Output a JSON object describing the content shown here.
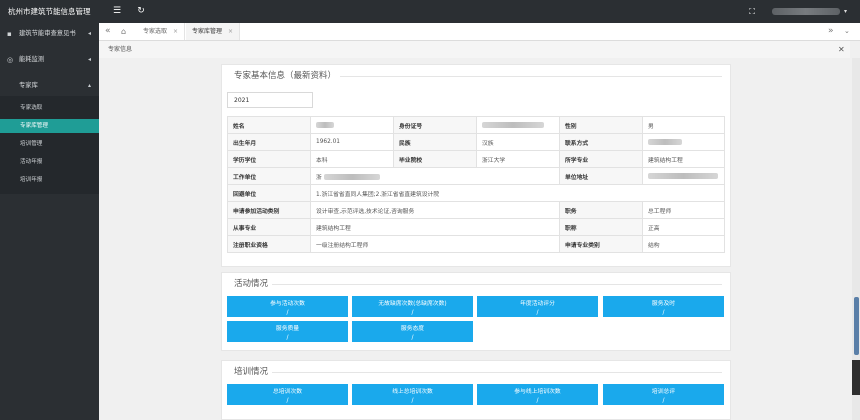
{
  "app": {
    "title": "杭州市建筑节能信息管理"
  },
  "sidebar": {
    "items": [
      {
        "label": "建筑节能审查意见书",
        "icon": "building-icon"
      },
      {
        "label": "能耗监测",
        "icon": "monitor-icon"
      },
      {
        "label": "专家库",
        "icon": ""
      }
    ],
    "subitems": [
      {
        "label": "专家选取"
      },
      {
        "label": "专家库管理"
      },
      {
        "label": "培训管理"
      },
      {
        "label": "活动年报"
      },
      {
        "label": "培训年报"
      }
    ]
  },
  "topbar": {
    "menu_icon": "☰",
    "refresh_icon": "↻",
    "fullscreen_icon": "⛶"
  },
  "tabs": [
    {
      "label": "专家选取",
      "close": "×"
    },
    {
      "label": "专家库管理",
      "close": "×"
    }
  ],
  "breadcrumb": {
    "label": "专家信息"
  },
  "basic": {
    "title": "专家基本信息（最新资料）",
    "year": "2021",
    "labels": {
      "name": "姓名",
      "id": "身份证号",
      "gender": "性别",
      "birth": "出生年月",
      "ethnic": "民族",
      "contact": "联系方式",
      "degree": "学历学位",
      "school": "毕业院校",
      "major": "所学专业",
      "work_unit": "工作单位",
      "unit_addr": "单位地址",
      "prev_unit": "回避单位",
      "activity_type": "申请参加活动类别",
      "position": "职务",
      "field": "从事专业",
      "title": "职称",
      "reg_cert": "注册职业资格",
      "apply_major": "申请专业类别"
    },
    "values": {
      "gender": "男",
      "birth": "1962.01",
      "ethnic": "汉族",
      "degree": "本科",
      "school": "浙江大学",
      "major": "建筑结构工程",
      "work_unit_prefix": "浙",
      "prev_unit": "1.浙江省省直同人集团;2.浙江省省直建筑设计院",
      "activity_type": "设计审查,示范评选,技术论证,咨询服务",
      "position": "总工程师",
      "field": "建筑结构工程",
      "title": "正高",
      "reg_cert": "一级注册结构工程师",
      "apply_major": "结构"
    }
  },
  "activity": {
    "title": "活动情况",
    "stats": [
      {
        "label": "参与活动次数",
        "value": "/"
      },
      {
        "label": "无故缺席次数(总缺席次数)",
        "value": "/"
      },
      {
        "label": "年度活动评分",
        "value": "/"
      },
      {
        "label": "服务及时",
        "value": "/"
      },
      {
        "label": "服务质量",
        "value": "/"
      },
      {
        "label": "服务态度",
        "value": "/"
      }
    ]
  },
  "training": {
    "title": "培训情况",
    "stats": [
      {
        "label": "总培训次数",
        "value": "/"
      },
      {
        "label": "线上总培训次数",
        "value": "/"
      },
      {
        "label": "参与线上培训次数",
        "value": "/"
      },
      {
        "label": "培训总评",
        "value": "/"
      }
    ]
  },
  "colors": {
    "sidebar": "#2b2f33",
    "active": "#1f9d96",
    "stat": "#1aa9ec"
  }
}
